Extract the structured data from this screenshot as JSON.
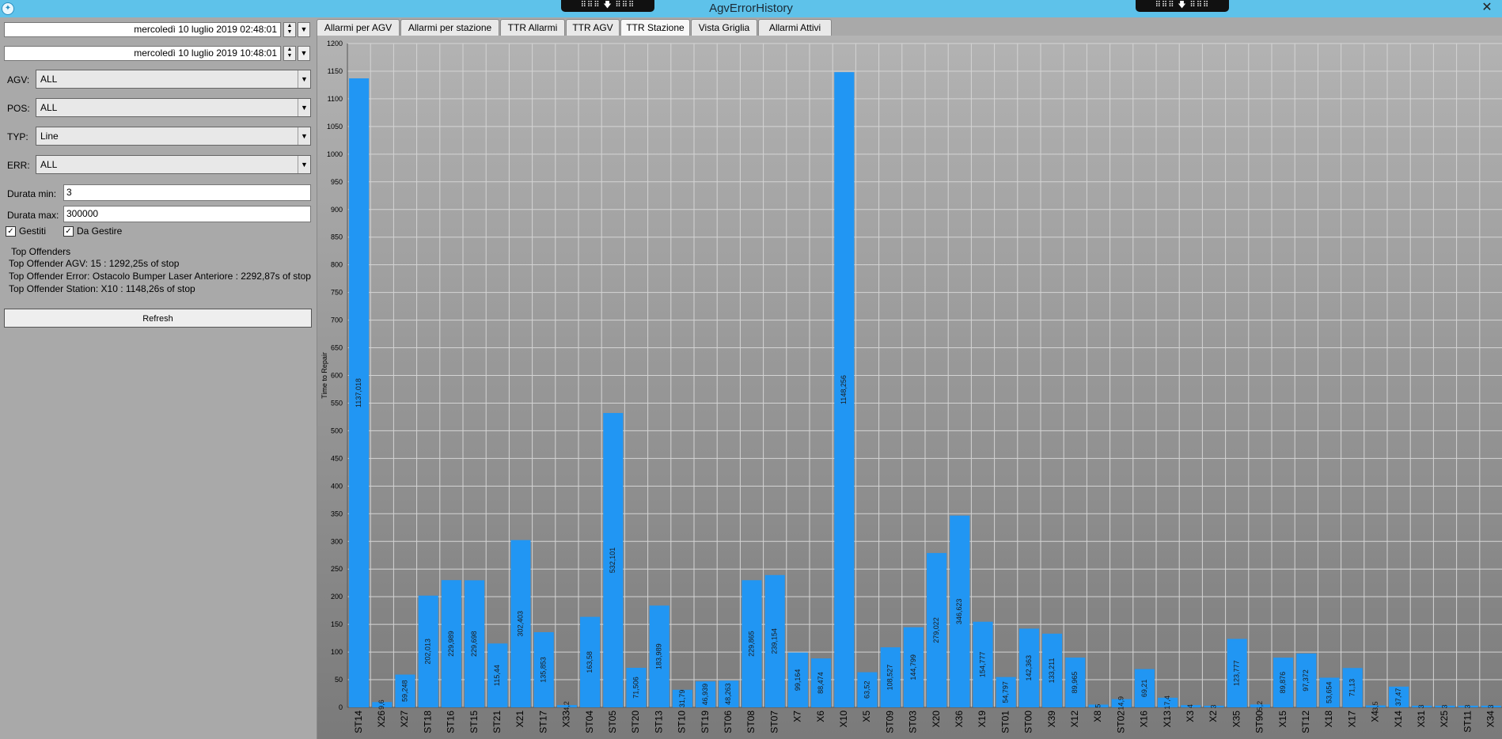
{
  "window": {
    "title": "AgvErrorHistory",
    "dock_handle": "⠿⠿⠿ 🡇 ⠿⠿⠿",
    "close_glyph": "✕",
    "app_icon": "app-icon"
  },
  "filters": {
    "date_from": "mercoledì 10 luglio 2019 02:48:01",
    "date_to": "mercoledì 10 luglio 2019 10:48:01",
    "agv_label": "AGV:",
    "agv_value": "ALL",
    "pos_label": "POS:",
    "pos_value": "ALL",
    "typ_label": "TYP:",
    "typ_value": "Line",
    "err_label": "ERR:",
    "err_value": "ALL",
    "durata_min_label": "Durata min:",
    "durata_min_value": "3",
    "durata_max_label": "Durata max:",
    "durata_max_value": "300000",
    "gestiti_label": "Gestiti",
    "da_gestire_label": "Da Gestire",
    "gestiti_checked": true,
    "da_gestire_checked": true
  },
  "offenders": {
    "title": "Top Offenders",
    "agv": "Top Offender AGV: 15 : 1292,25s of stop",
    "error": "Top Offender Error: Ostacolo Bumper Laser Anteriore : 2292,87s of stop",
    "station": "Top Offender Station: X10 : 1148,26s of stop"
  },
  "refresh_label": "Refresh",
  "tabs": [
    {
      "label": "Allarmi per AGV"
    },
    {
      "label": "Allarmi per stazione"
    },
    {
      "label": "TTR Allarmi"
    },
    {
      "label": "TTR AGV"
    },
    {
      "label": "TTR Stazione",
      "active": true
    },
    {
      "label": "Vista Griglia"
    },
    {
      "label": "Allarmi Attivi"
    }
  ],
  "chart_data": {
    "type": "bar",
    "ylabel": "Time to Repair",
    "ylim": [
      0,
      1200
    ],
    "ytick_step": 50,
    "grid": true,
    "bar_color": "#2196f3",
    "categories": [
      "ST14",
      "X26",
      "X27",
      "ST18",
      "ST16",
      "ST15",
      "ST21",
      "X21",
      "ST17",
      "X33",
      "ST04",
      "ST05",
      "ST20",
      "ST13",
      "ST10",
      "ST19",
      "ST06",
      "ST08",
      "ST07",
      "X7",
      "X6",
      "X10",
      "X5",
      "ST09",
      "ST03",
      "X20",
      "X36",
      "X19",
      "ST01",
      "ST00",
      "X39",
      "X12",
      "X8",
      "ST02",
      "X16",
      "X13",
      "X3",
      "X2",
      "X35",
      "ST90",
      "X15",
      "ST12",
      "X18",
      "X17",
      "X4",
      "X14",
      "X31",
      "X25",
      "ST11",
      "X34"
    ],
    "values": [
      1137.018,
      9.6,
      59.248,
      202.013,
      229.989,
      229.698,
      115.44,
      302.403,
      135.853,
      4.2,
      163.58,
      532.101,
      71.506,
      183.989,
      31.79,
      46.939,
      48.263,
      229.865,
      239.154,
      99.164,
      88.474,
      1148.256,
      63.52,
      108.527,
      144.799,
      279.022,
      346.623,
      154.777,
      54.797,
      142.363,
      133.211,
      89.965,
      5.0,
      14.9,
      69.21,
      17.4,
      4.0,
      3.0,
      123.777,
      5.2,
      89.876,
      97.372,
      53.654,
      71.13,
      3.5,
      37.47,
      3.0,
      3.0,
      3.0,
      3.0
    ],
    "labels": [
      "1137,018",
      "9,6",
      "59,248",
      "202,013",
      "229,989",
      "229,698",
      "115,44",
      "302,403",
      "135,853",
      "4,2",
      "163,58",
      "532,101",
      "71,506",
      "183,989",
      "31,79",
      "46,939",
      "48,263",
      "229,865",
      "239,154",
      "99,164",
      "88,474",
      "1148,256",
      "63,52",
      "108,527",
      "144,799",
      "279,022",
      "346,623",
      "154,777",
      "54,797",
      "142,363",
      "133,211",
      "89,965",
      "5",
      "14,9",
      "69,21",
      "17,4",
      "4",
      "3",
      "123,777",
      "5,2",
      "89,876",
      "97,372",
      "53,654",
      "71,13",
      "3,5",
      "37,47",
      "3",
      "3",
      "3",
      "3"
    ]
  }
}
